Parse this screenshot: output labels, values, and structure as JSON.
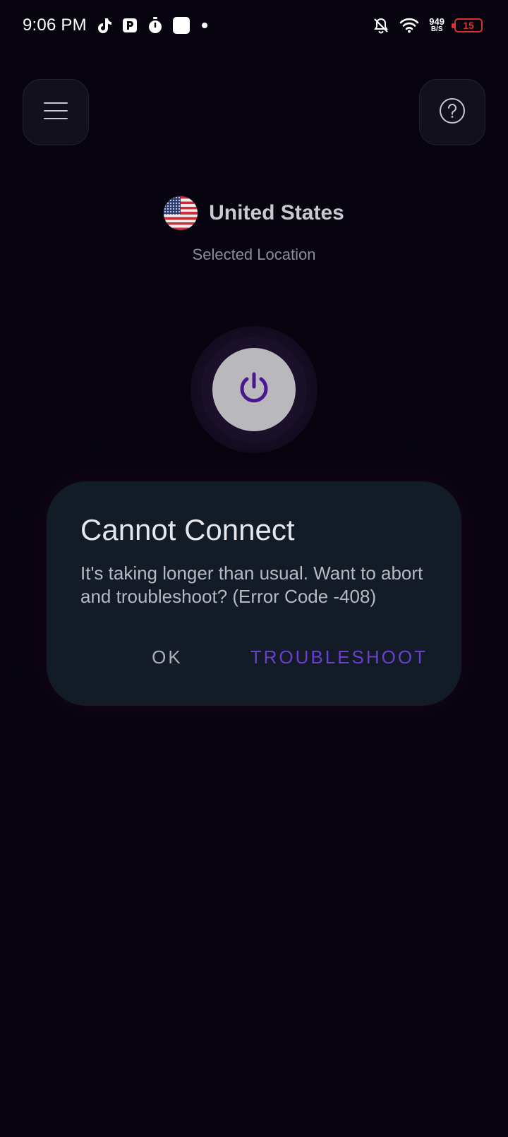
{
  "status_bar": {
    "time": "9:06 PM",
    "net_speed_value": "949",
    "net_speed_unit": "B/S",
    "battery_level": "15",
    "icons": [
      "tiktok-icon",
      "app-p-icon",
      "timer-icon",
      "white-square-icon",
      "dot-icon",
      "bell-off-icon",
      "wifi-icon",
      "battery-icon"
    ],
    "battery_color": "#d9322c"
  },
  "header": {
    "menu_icon": "hamburger-menu-icon",
    "help_icon": "help-question-icon"
  },
  "location": {
    "country": "United States",
    "subtitle": "Selected Location",
    "flag": "us-flag-icon"
  },
  "power": {
    "icon": "power-icon",
    "accent": "#4a178f"
  },
  "dialog": {
    "title": "Cannot Connect",
    "message": "It's taking longer than usual. Want to abort and troubleshoot? (Error Code -408)",
    "ok_label": "OK",
    "troubleshoot_label": "TROUBLESHOOT",
    "accent": "#6a3fd0"
  }
}
